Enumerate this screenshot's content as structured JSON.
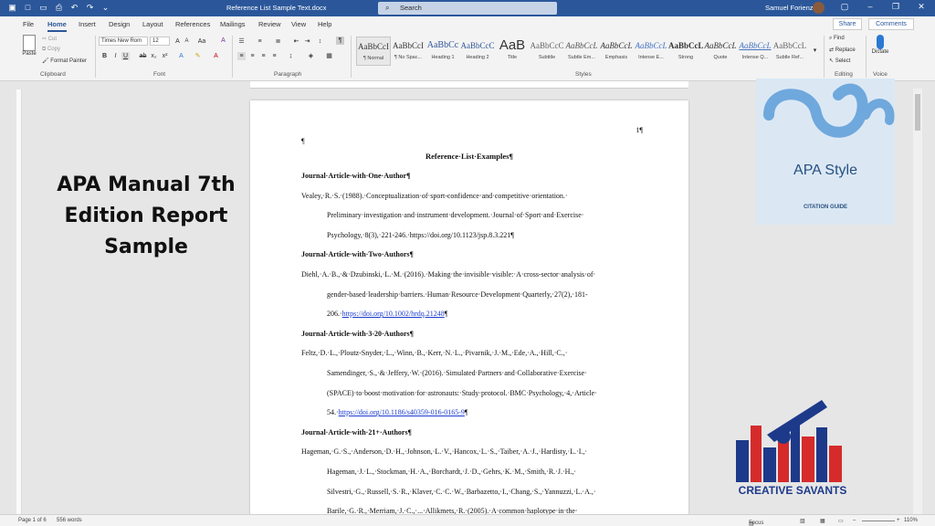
{
  "titlebar": {
    "doc_title": "Reference List Sample Text.docx",
    "search": "Search",
    "user": "Samuel Forienza"
  },
  "menu": {
    "tabs": [
      "File",
      "Home",
      "Insert",
      "Design",
      "Layout",
      "References",
      "Mailings",
      "Review",
      "View",
      "Help"
    ],
    "share": "Share",
    "comments": "Comments"
  },
  "ribbon": {
    "clipboard": {
      "label": "Clipboard",
      "paste": "Paste",
      "cut": "Cut",
      "copy": "Copy",
      "format_painter": "Format Painter"
    },
    "font": {
      "label": "Font",
      "name": "Times New Rom",
      "size": "12"
    },
    "paragraph": {
      "label": "Paragraph"
    },
    "styles": {
      "label": "Styles",
      "items": [
        {
          "preview": "AaBbCcI",
          "name": "¶ Normal"
        },
        {
          "preview": "AaBbCcI",
          "name": "¶ No Spac..."
        },
        {
          "preview": "AaBbCc",
          "name": "Heading 1"
        },
        {
          "preview": "AaBbCcC",
          "name": "Heading 2"
        },
        {
          "preview": "AaB",
          "name": "Title"
        },
        {
          "preview": "AaBbCcC",
          "name": "Subtitle"
        },
        {
          "preview": "AaBbCcL",
          "name": "Subtle Em..."
        },
        {
          "preview": "AaBbCcL",
          "name": "Emphasis"
        },
        {
          "preview": "AaBbCcL",
          "name": "Intense E..."
        },
        {
          "preview": "AaBbCcL",
          "name": "Strong"
        },
        {
          "preview": "AaBbCcL",
          "name": "Quote"
        },
        {
          "preview": "AaBbCcL",
          "name": "Intense Q..."
        },
        {
          "preview": "AaBbCcL",
          "name": "Subtle Ref..."
        }
      ]
    },
    "editing": {
      "label": "Editing",
      "find": "Find",
      "replace": "Replace",
      "select": "Select"
    },
    "voice": {
      "label": "Voice",
      "dictate": "Dictate"
    }
  },
  "document": {
    "page_number": "1¶",
    "para_mark": "¶",
    "heading": "Reference·List·Examples¶",
    "lines": [
      {
        "text": "Journal·Article·with·One·Author¶",
        "style": "bold"
      },
      {
        "text": "Vealey,·R.·S.·(1988).·Conceptualization·of·sport-confidence·and·competitive·orientation.·",
        "style": ""
      },
      {
        "text": "Preliminary·investigation·and·instrument·development.·Journal·of·Sport·and·Exercise·",
        "style": "indent"
      },
      {
        "text": "Psychology,·8(3),·221-246.·https://doi.org/10.1123/jsp.8.3.221¶",
        "style": "indent"
      },
      {
        "text": "Journal·Article·with·Two·Authors¶",
        "style": "bold"
      },
      {
        "text": "Diehl,·A.·B.,·&·Dzubinski,·L.·M.·(2016).·Making·the·invisible·visible:·A·cross-sector·analysis·of·",
        "style": ""
      },
      {
        "text": "gender-based·leadership·barriers.·Human·Resource·Development·Quarterly,·27(2),·181-",
        "style": "indent"
      },
      {
        "text": "206.·",
        "link": "https://doi.org/10.1002/hrdq.21248",
        "tail": "¶",
        "style": "indent"
      },
      {
        "text": "Journal·Article·with·3-20·Authors¶",
        "style": "bold"
      },
      {
        "text": "Feltz,·D.·L.,·Ploutz-Snyder,·L.,·Winn,·B.,·Kerr,·N.·L.,·Pivarnik,·J.·M.,·Ede,·A.,·Hill,·C.,·",
        "style": ""
      },
      {
        "text": "Samendinger,·S.,·&·Jeffery,·W.·(2016).·Simulated·Partners·and·Collaborative·Exercise·",
        "style": "indent"
      },
      {
        "text": "(SPACE)·to·boost·motivation·for·astronauts:·Study·protocol.·BMC·Psychology,·4,·Article·",
        "style": "indent"
      },
      {
        "text": "54.·",
        "link": "https://doi.org/10.1186/s40359-016-0165-9",
        "tail": "¶",
        "style": "indent"
      },
      {
        "text": "Journal·Article·with·21+·Authors¶",
        "style": "bold"
      },
      {
        "text": "Hageman,·G.·S.,·Anderson,·D.·H.,·Johnson,·L.·V.,·Hancox,·L.·S.,·Taiber,·A.·J.,·Hardisty,·L.·I.,·",
        "style": ""
      },
      {
        "text": "Hageman,·J.·L.,·Stockman,·H.·A.,·Borchardt,·J.·D.,·Gehrs,·K.·M.,·Smith,·R.·J.·H.,·",
        "style": "indent"
      },
      {
        "text": "Silvestri,·G.,·Russell,·S.·R.,·Klaver,·C.·C.·W.,·Barbazetto,·I.,·Chang,·S.,·Yannuzzi,·L.·A.,·",
        "style": "indent"
      },
      {
        "text": "Barile,·G.·R.,·Merriam,·J.·C.,·...·Allikmets,·R.·(2005).·A·common·haplotype·in·the·",
        "style": "indent"
      }
    ]
  },
  "status": {
    "page": "Page 1 of 6",
    "words": "556 words",
    "focus": "Focus",
    "zoom": "110%"
  },
  "overlay": {
    "title_lines": [
      "APA Manual 7th",
      "Edition Report",
      "Sample"
    ],
    "apa_brand": "APA Style",
    "apa_sub": "CITATION GUIDE",
    "creative": "CREATIVE SAVANTS"
  },
  "colors": {
    "word_blue": "#2b579a",
    "apa_blue": "#27507f"
  }
}
